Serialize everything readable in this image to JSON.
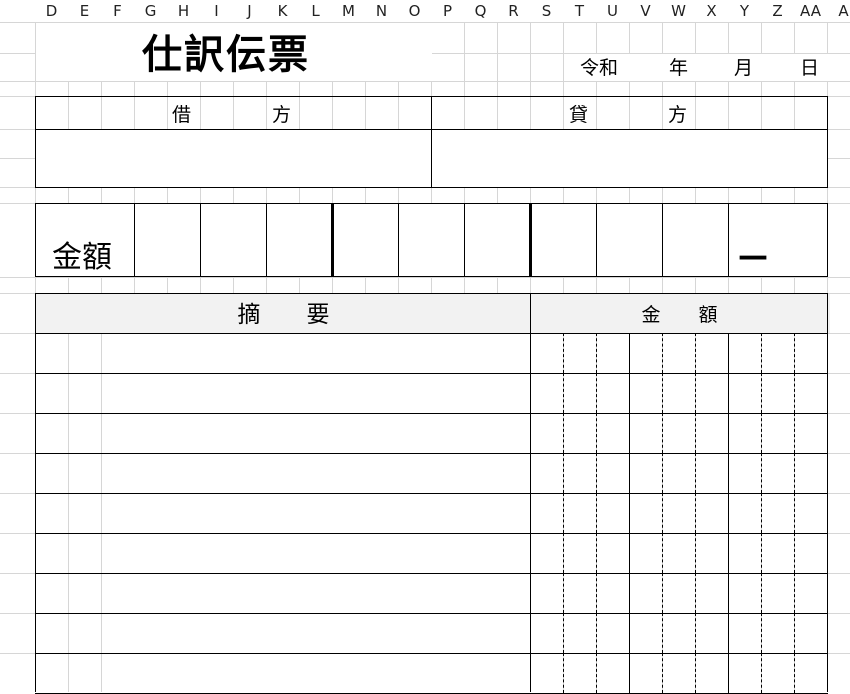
{
  "column_headers": [
    "D",
    "E",
    "F",
    "G",
    "H",
    "I",
    "J",
    "K",
    "L",
    "M",
    "N",
    "O",
    "P",
    "Q",
    "R",
    "S",
    "T",
    "U",
    "V",
    "W",
    "X",
    "Y",
    "Z",
    "AA",
    "A"
  ],
  "form": {
    "title": "仕訳伝票",
    "date": {
      "era": "令和",
      "year": "年",
      "month": "月",
      "day": "日"
    },
    "debit_header": {
      "char1": "借",
      "char2": "方"
    },
    "credit_header": {
      "char1": "貸",
      "char2": "方"
    },
    "amount_label": "金額",
    "dash_mark": "—",
    "description_header": "摘　　要",
    "amount_header": "金　　額"
  }
}
